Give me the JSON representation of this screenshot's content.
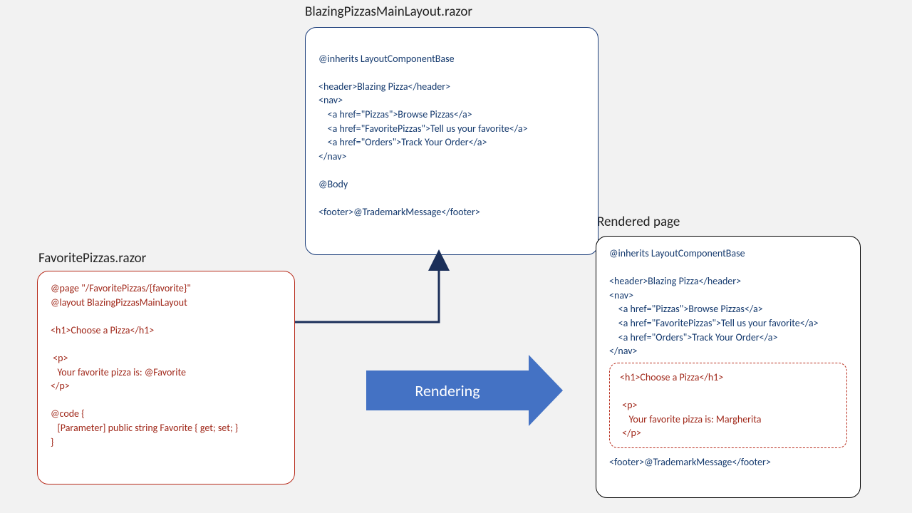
{
  "titles": {
    "favorite": "FavoritePizzas.razor",
    "layout": "BlazingPizzasMainLayout.razor",
    "rendered": "Rendered page"
  },
  "arrowLabel": "Rendering",
  "favoriteBox": {
    "l1": "@page \"/FavoritePizzas/{favorite}\"",
    "l2": "@layout BlazingPizzasMainLayout",
    "l3": "<h1>Choose a Pizza</h1>",
    "l4": " <p>",
    "l5": "   Your favorite pizza is: @Favorite",
    "l6": "</p>",
    "l7": "@code {",
    "l8": "   [Parameter] public string Favorite { get; set; }",
    "l9": "}"
  },
  "layoutBox": {
    "l1": "@inherits LayoutComponentBase",
    "l2": "<header>Blazing Pizza</header>",
    "l3": "<nav>",
    "l4": "    <a href=\"Pizzas\">Browse Pizzas</a>",
    "l5": "    <a href=\"FavoritePizzas\">Tell us your favorite</a>",
    "l6": "    <a href=\"Orders\">Track Your Order</a>",
    "l7": "</nav>",
    "l8": "@Body",
    "l9": "<footer>@TrademarkMessage</footer>"
  },
  "renderedBox": {
    "l1": "@inherits LayoutComponentBase",
    "l2": "<header>Blazing Pizza</header>",
    "l3": "<nav>",
    "l4": "    <a href=\"Pizzas\">Browse Pizzas</a>",
    "l5": "    <a href=\"FavoritePizzas\">Tell us your favorite</a>",
    "l6": "    <a href=\"Orders\">Track Your Order</a>",
    "l7": "</nav>",
    "b1": "<h1>Choose a Pizza</h1>",
    "b2": " <p>",
    "b3": "    Your favorite pizza is: Margherita",
    "b4": " </p>",
    "l8": "<footer>@TrademarkMessage</footer>"
  }
}
